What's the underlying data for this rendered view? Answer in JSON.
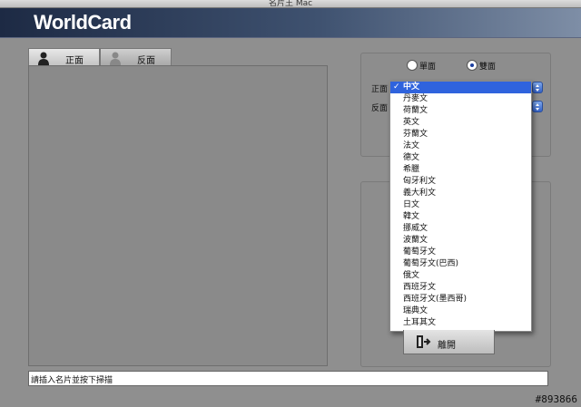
{
  "window": {
    "title": "名片王 Mac"
  },
  "app": {
    "brand": "WorldCard"
  },
  "tabs": [
    {
      "label": "正面",
      "icon": "person-dark-icon"
    },
    {
      "label": "反面",
      "icon": "person-light-icon"
    }
  ],
  "sides": {
    "single_label": "單面",
    "double_label": "雙面",
    "selected": "雙面"
  },
  "language": {
    "front_label": "正面",
    "back_label": "反面",
    "front_selected": "中文",
    "options": [
      "中文",
      "丹麥文",
      "荷蘭文",
      "英文",
      "芬蘭文",
      "法文",
      "德文",
      "希臘",
      "匈牙利文",
      "義大利文",
      "日文",
      "韓文",
      "挪威文",
      "波蘭文",
      "葡萄牙文",
      "葡萄牙文(巴西)",
      "俄文",
      "西班牙文",
      "西班牙文(墨西哥)",
      "瑞典文",
      "土耳其文"
    ]
  },
  "actions": {
    "exit_label": "離開"
  },
  "status": {
    "text": "請插入名片並按下掃描"
  },
  "watermark": "#893866",
  "colors": {
    "selection": "#2f63dd",
    "header_dark": "#1d2a44"
  }
}
